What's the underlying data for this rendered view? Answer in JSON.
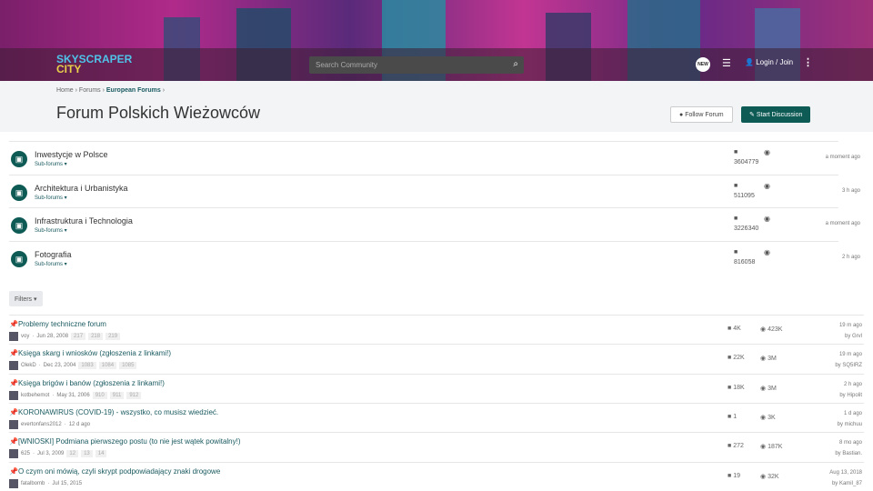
{
  "header": {
    "logo_top": "SKYSCRAPER",
    "logo_bottom": "CITY",
    "search_placeholder": "Search Community",
    "new_badge": "NEW",
    "login": "Login / Join"
  },
  "breadcrumb": [
    "Home",
    "Forums",
    "European Forums"
  ],
  "page_title": "Forum Polskich Wieżowców",
  "buttons": {
    "follow": "Follow Forum",
    "start": "Start Discussion",
    "filters": "Filters"
  },
  "subforums": [
    {
      "title": "Inwestycje w Polsce",
      "sub": "Sub-forums",
      "count": "3604779",
      "time": "a moment ago"
    },
    {
      "title": "Architektura i Urbanistyka",
      "sub": "Sub-forums",
      "count": "511095",
      "time": "3 h ago"
    },
    {
      "title": "Infrastruktura i Technologia",
      "sub": "Sub-forums",
      "count": "3226340",
      "time": "a moment ago"
    },
    {
      "title": "Fotografia",
      "sub": "Sub-forums",
      "count": "816058",
      "time": "2 h ago"
    }
  ],
  "threads": [
    {
      "title": "Problemy techniczne forum",
      "author": "voy",
      "date": "Jun 28, 2008",
      "pages": [
        "217",
        "218",
        "219"
      ],
      "replies": "4K",
      "views": "423K",
      "last": "19 m ago",
      "by": "by Grvl"
    },
    {
      "title": "Księga skarg i wniosków (zgłoszenia z linkami!)",
      "author": "OlekD",
      "date": "Dec 23, 2004",
      "pages": [
        "1083",
        "1084",
        "1085"
      ],
      "replies": "22K",
      "views": "3M",
      "last": "19 m ago",
      "by": "by SQ5IRZ"
    },
    {
      "title": "Księga brigów i banów (zgłoszenia z linkami!)",
      "author": "kotbehemot",
      "date": "May 31, 2006",
      "pages": [
        "910",
        "911",
        "912"
      ],
      "replies": "18K",
      "views": "3M",
      "last": "2 h ago",
      "by": "by Hipolit"
    },
    {
      "title": "KORONAWIRUS (COVID-19) - wszystko, co musisz wiedzieć.",
      "author": "evertonfans2012",
      "date": "12 d ago",
      "pages": [],
      "replies": "1",
      "views": "3K",
      "last": "1 d ago",
      "by": "by michuu"
    },
    {
      "title": "[WNIOSKI] Podmiana pierwszego postu (to nie jest wątek powitalny!)",
      "author": "625",
      "date": "Jul 3, 2009",
      "pages": [
        "12",
        "13",
        "14"
      ],
      "replies": "272",
      "views": "187K",
      "last": "8 mo ago",
      "by": "by Bastian."
    },
    {
      "title": "O czym oni mówią, czyli skrypt podpowiadający znaki drogowe",
      "author": "fatalbomb",
      "date": "Jul 15, 2015",
      "pages": [],
      "replies": "19",
      "views": "32K",
      "last": "Aug 13, 2018",
      "by": "by Kamil_87"
    }
  ]
}
